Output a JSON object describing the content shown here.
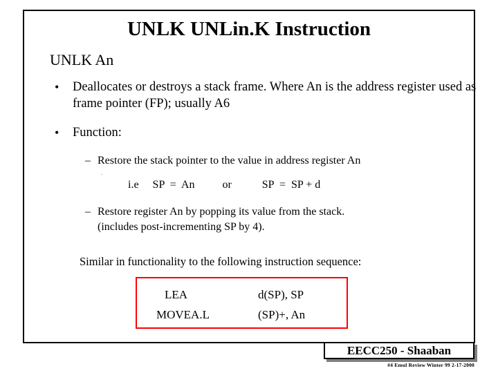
{
  "slide": {
    "title": "UNLK  UNLin.K Instruction",
    "subhead": "UNLK  An",
    "bullets": [
      {
        "marker": "•",
        "text": "Deallocates or destroys a stack frame.   Where An  is the address register used as frame pointer (FP); usually A6"
      },
      {
        "marker": "•",
        "text": "Function:"
      }
    ],
    "sub_bullets": [
      {
        "marker": "–",
        "text": "Restore the stack pointer to the value in  address register An"
      },
      {
        "marker": "–",
        "text": "Restore register An  by popping its value from the stack."
      }
    ],
    "ie_line": "i.e     SP  =  An          or           SP  =  SP + d",
    "tiny_mark": ".",
    "post_increment_line": "(includes post-incrementing SP by 4).",
    "similar_line": "Similar in functionality to the following instruction sequence:",
    "code_box": {
      "rows": [
        {
          "mnemonic": "LEA",
          "operand": "d(SP), SP"
        },
        {
          "mnemonic": "MOVEA.L",
          "operand": "(SP)+, An"
        }
      ],
      "border_color": "#ff0000"
    },
    "footer": {
      "label": "EECC250 - Shaaban",
      "note": "#4  Emul Review  Winter 99  2-17-2000"
    }
  }
}
